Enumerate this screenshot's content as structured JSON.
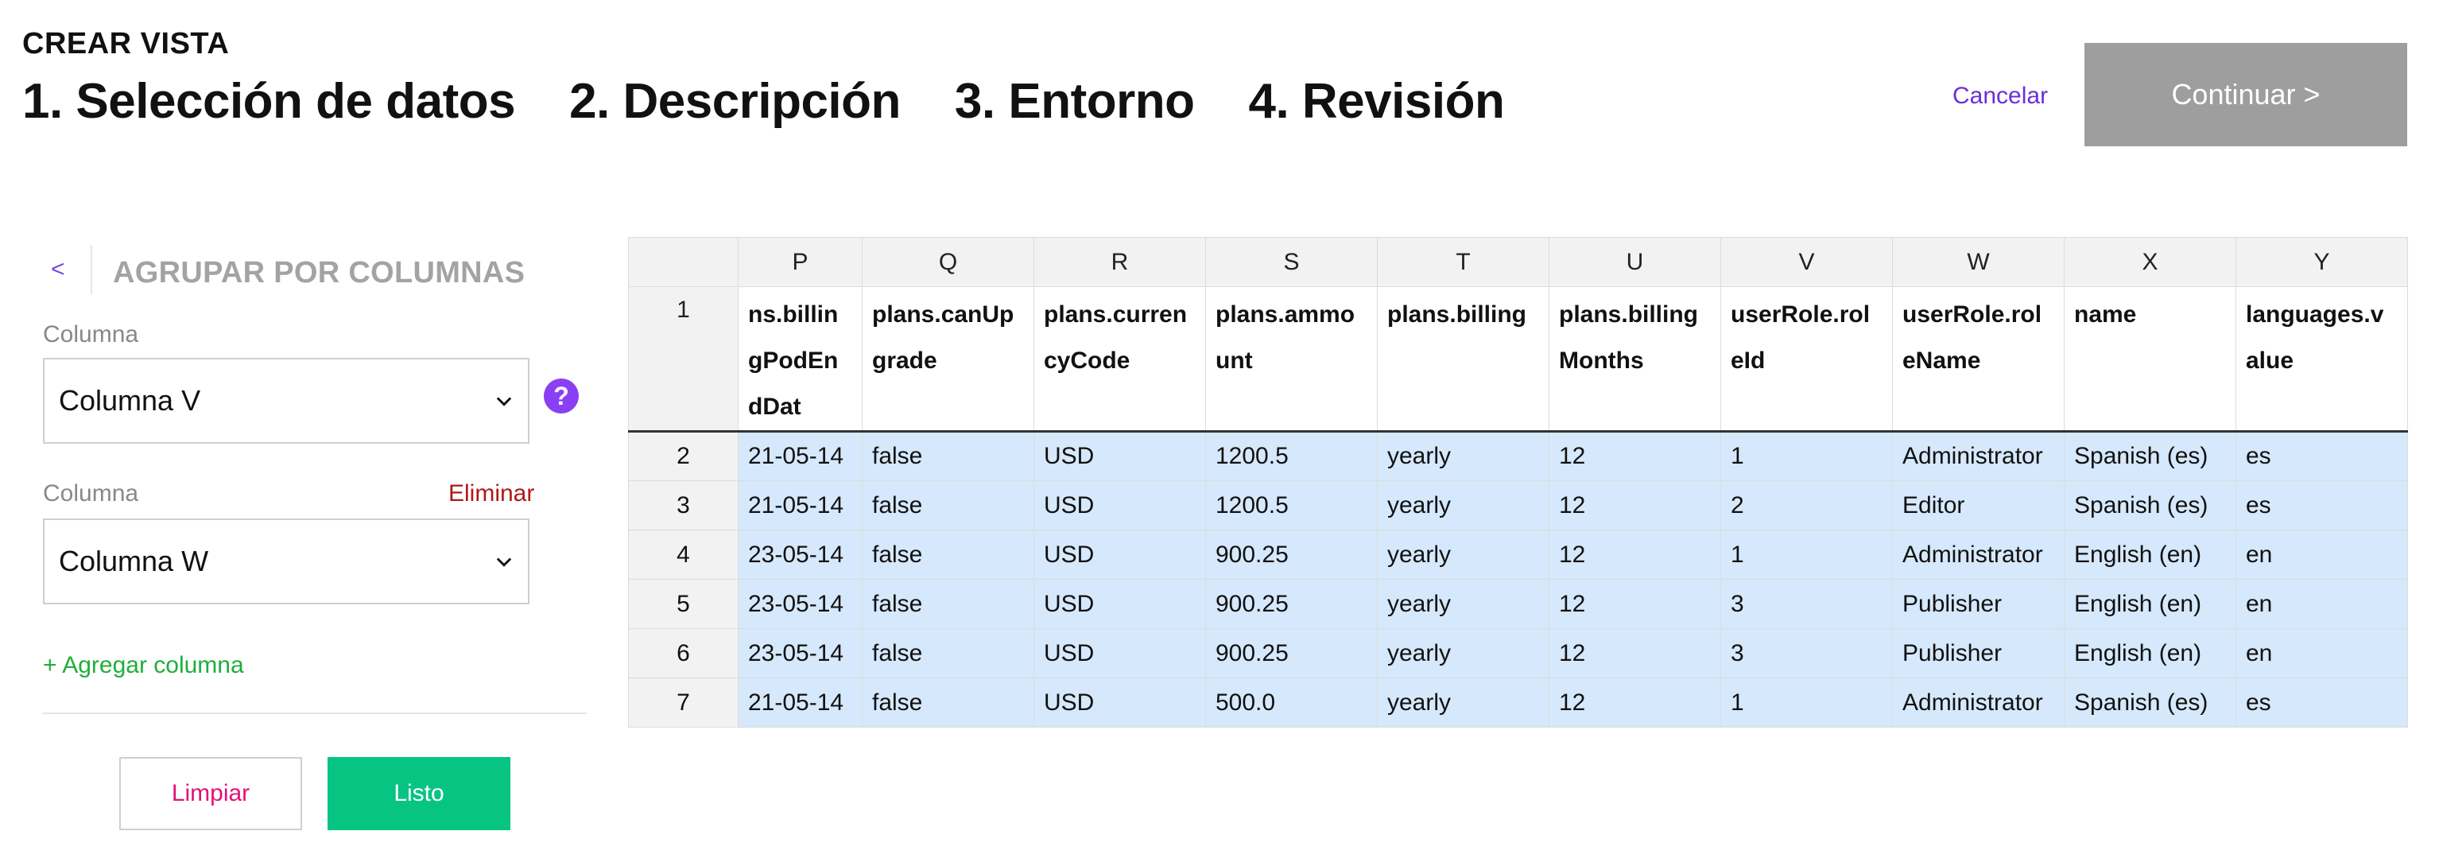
{
  "header": {
    "title": "CREAR VISTA",
    "steps": [
      "1. Selección de datos",
      "2. Descripción",
      "3. Entorno",
      "4. Revisión"
    ],
    "cancel_label": "Cancelar",
    "continue_label": "Continuar >"
  },
  "sidebar": {
    "back_icon": "<",
    "title": "AGRUPAR POR COLUMNAS",
    "fields": [
      {
        "label": "Columna",
        "value": "Columna V"
      },
      {
        "label": "Columna",
        "value": "Columna W",
        "remove_label": "Eliminar"
      }
    ],
    "help_icon": "?",
    "add_column_label": "+ Agregar columna",
    "clear_label": "Limpiar",
    "done_label": "Listo"
  },
  "grid": {
    "column_letters": [
      "P",
      "Q",
      "R",
      "S",
      "T",
      "U",
      "V",
      "W",
      "X",
      "Y"
    ],
    "header_row_number": "1",
    "headers": [
      "ns.billingPodEndDat",
      "plans.canUpgrade",
      "plans.currencyCode",
      "plans.ammount",
      "plans.billing",
      "plans.billingMonths",
      "userRole.roleId",
      "userRole.roleName",
      "name",
      "languages.value"
    ],
    "rows": [
      {
        "n": "2",
        "cells": [
          "21-05-14",
          "false",
          "USD",
          "1200.5",
          "yearly",
          "12",
          "1",
          "Administrator",
          "Spanish (es)",
          "es"
        ]
      },
      {
        "n": "3",
        "cells": [
          "21-05-14",
          "false",
          "USD",
          "1200.5",
          "yearly",
          "12",
          "2",
          "Editor",
          "Spanish (es)",
          "es"
        ]
      },
      {
        "n": "4",
        "cells": [
          "23-05-14",
          "false",
          "USD",
          "900.25",
          "yearly",
          "12",
          "1",
          "Administrator",
          "English (en)",
          "en"
        ]
      },
      {
        "n": "5",
        "cells": [
          "23-05-14",
          "false",
          "USD",
          "900.25",
          "yearly",
          "12",
          "3",
          "Publisher",
          "English (en)",
          "en"
        ]
      },
      {
        "n": "6",
        "cells": [
          "23-05-14",
          "false",
          "USD",
          "900.25",
          "yearly",
          "12",
          "3",
          "Publisher",
          "English (en)",
          "en"
        ]
      },
      {
        "n": "7",
        "cells": [
          "21-05-14",
          "false",
          "USD",
          "500.0",
          "yearly",
          "12",
          "1",
          "Administrator",
          "Spanish (es)",
          "es"
        ]
      }
    ]
  }
}
